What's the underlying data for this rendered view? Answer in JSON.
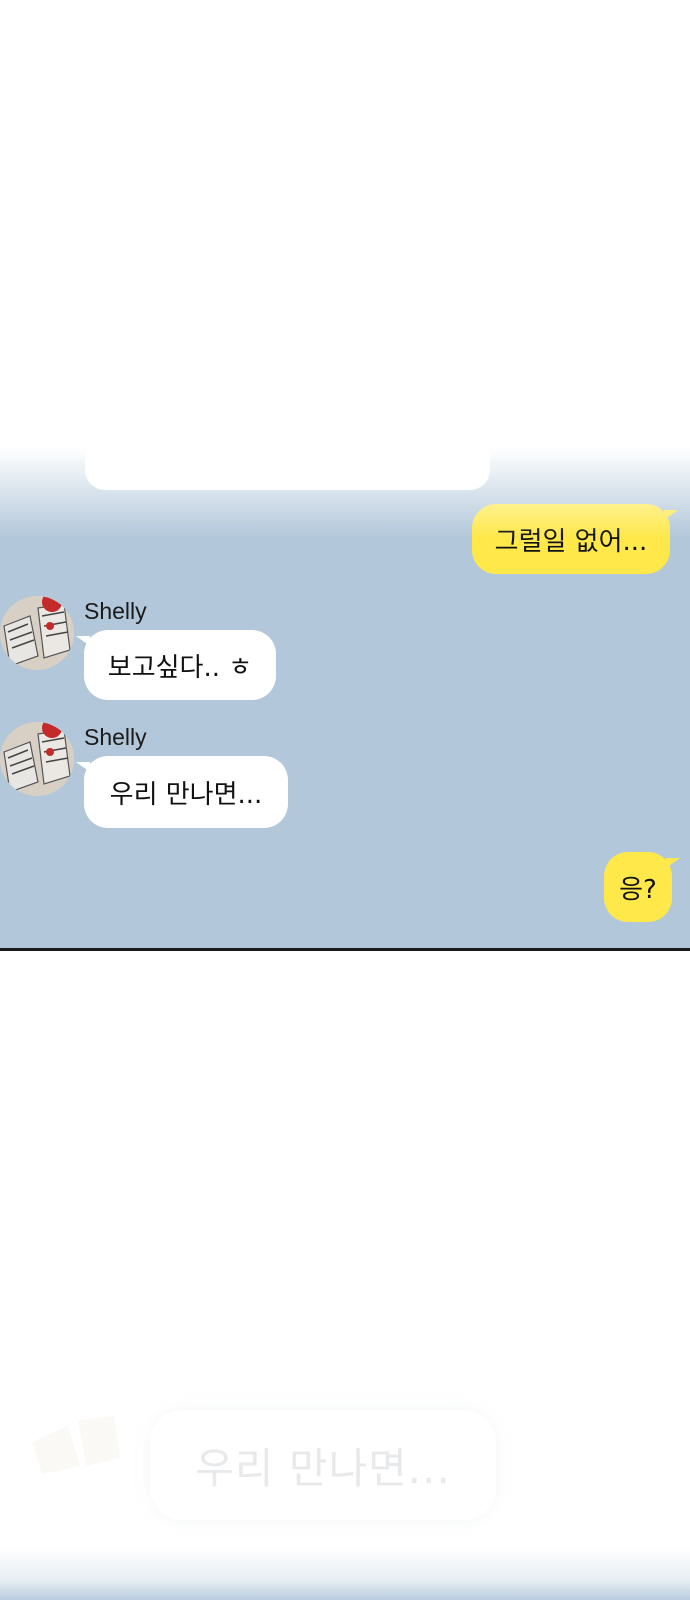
{
  "conversation": {
    "faded_partial_message": "",
    "messages": [
      {
        "side": "me",
        "text": "그럴일 없어..."
      },
      {
        "side": "them",
        "sender": "Shelly",
        "text": "보고싶다.. ㅎ"
      },
      {
        "side": "them",
        "sender": "Shelly",
        "text": "우리 만나면..."
      },
      {
        "side": "me",
        "text": "응?"
      }
    ]
  },
  "lower_panel": {
    "faded_message": "우리 만나면..."
  },
  "colors": {
    "chat_background": "#b2c7da",
    "my_bubble": "#fee84a",
    "their_bubble": "#ffffff"
  },
  "icons": {
    "avatar": "sneakers-avatar-icon"
  }
}
